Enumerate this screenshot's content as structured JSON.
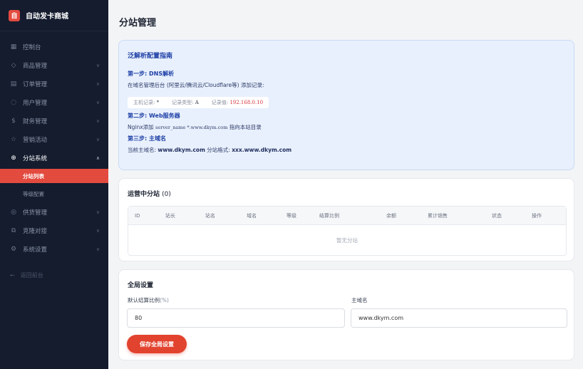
{
  "brand": {
    "logo_char": "自",
    "name": "自动发卡商城"
  },
  "sidebar": {
    "items": [
      {
        "label": "控制台",
        "icon": "dashboard-icon",
        "glyph": "▦",
        "has_chevron": false
      },
      {
        "label": "商品管理",
        "icon": "box-icon",
        "glyph": "◇",
        "has_chevron": true
      },
      {
        "label": "订单管理",
        "icon": "document-icon",
        "glyph": "▤",
        "has_chevron": true
      },
      {
        "label": "用户管理",
        "icon": "users-icon",
        "glyph": "◌",
        "has_chevron": true
      },
      {
        "label": "财务管理",
        "icon": "dollar-icon",
        "glyph": "$",
        "has_chevron": true
      },
      {
        "label": "营销活动",
        "icon": "star-icon",
        "glyph": "☆",
        "has_chevron": true
      },
      {
        "label": "分站系统",
        "icon": "globe-icon",
        "glyph": "⊕",
        "has_chevron": true,
        "expanded": true
      },
      {
        "label": "供货管理",
        "icon": "supply-icon",
        "glyph": "◎",
        "has_chevron": true
      },
      {
        "label": "克隆对接",
        "icon": "clone-icon",
        "glyph": "⧉",
        "has_chevron": true
      },
      {
        "label": "系统设置",
        "icon": "gear-icon",
        "glyph": "⚙",
        "has_chevron": true
      }
    ],
    "sub_items": [
      {
        "label": "分站列表",
        "active": true
      },
      {
        "label": "等级配置",
        "active": false
      }
    ],
    "back_label": "返回前台"
  },
  "page": {
    "title": "分站管理"
  },
  "guide": {
    "title": "泛解析配置指南",
    "step1_title": "第一步: DNS解析",
    "step1_text": "在域名管理后台 (阿里云/腾讯云/Cloudflare等) 添加记录:",
    "record_host_label": "主机记录:",
    "record_host_value": "*",
    "record_type_label": "记录类型:",
    "record_type_value": "A",
    "record_value_label": "记录值:",
    "record_value_value": "192.168.0.10",
    "step2_title": "第二步: Web服务器",
    "step2_prefix": "Nginx添加",
    "step2_code": "server_name *.www.dkym.com",
    "step2_suffix": "指向本站目录",
    "step3_title": "第三步: 主域名",
    "step3_main_label": "当前主域名:",
    "step3_main_value": "www.dkym.com",
    "step3_format_label": "分站格式:",
    "step3_format_value": "xxx.www.dkym.com"
  },
  "substations": {
    "title": "运营中分站",
    "count": "(0)",
    "columns": [
      "ID",
      "站长",
      "站名",
      "域名",
      "等级",
      "结算比例",
      "余额",
      "累计销售",
      "状态",
      "操作"
    ],
    "empty_text": "暂无分站"
  },
  "global_settings": {
    "title": "全局设置",
    "ratio_label": "默认结算比例",
    "ratio_unit": "(%)",
    "ratio_value": "80",
    "domain_label": "主域名",
    "domain_value": "www.dkym.com",
    "save_label": "保存全局设置"
  },
  "colors": {
    "sidebar_bg": "#141c2e",
    "accent": "#e34b3f",
    "guide_bg": "#e8f0fd",
    "guide_text": "#1d3fa6"
  }
}
